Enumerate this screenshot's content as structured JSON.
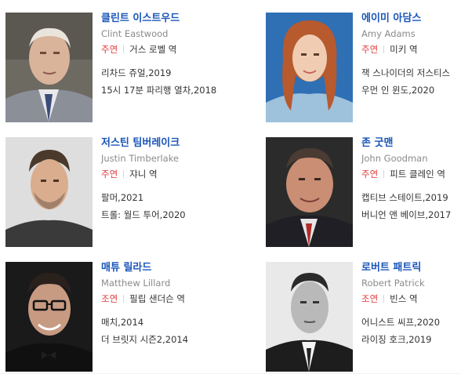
{
  "cast": [
    {
      "name_ko": "클린트 이스트우드",
      "name_en": "Clint Eastwood",
      "role_type": "주연",
      "role": "거스 로벨 역",
      "works": [
        "리차드 쥬얼,2019",
        "15시 17분 파리행 열차,2018"
      ]
    },
    {
      "name_ko": "에이미 아담스",
      "name_en": "Amy Adams",
      "role_type": "주연",
      "role": "미키 역",
      "works": [
        "잭 스나이더의 저스티스",
        "우먼 인 윈도,2020"
      ]
    },
    {
      "name_ko": "저스틴 팀버레이크",
      "name_en": "Justin Timberlake",
      "role_type": "주연",
      "role": "쟈니 역",
      "works": [
        "팔머,2021",
        "트롤: 월드 투어,2020"
      ]
    },
    {
      "name_ko": "존 굿맨",
      "name_en": "John Goodman",
      "role_type": "주연",
      "role": "피트 클레인 역",
      "works": [
        "캡티브 스테이트,2019",
        "버니언 앤 베이브,2017"
      ]
    },
    {
      "name_ko": "매튜 릴라드",
      "name_en": "Matthew Lillard",
      "role_type": "조연",
      "role": "필립 샌더슨 역",
      "works": [
        "매치,2014",
        "더 브릿지 시즌2,2014"
      ]
    },
    {
      "name_ko": "로버트 패트릭",
      "name_en": "Robert Patrick",
      "role_type": "조연",
      "role": "빈스 역",
      "works": [
        "어니스트 씨프,2020",
        "라이징 호크,2019"
      ]
    }
  ]
}
